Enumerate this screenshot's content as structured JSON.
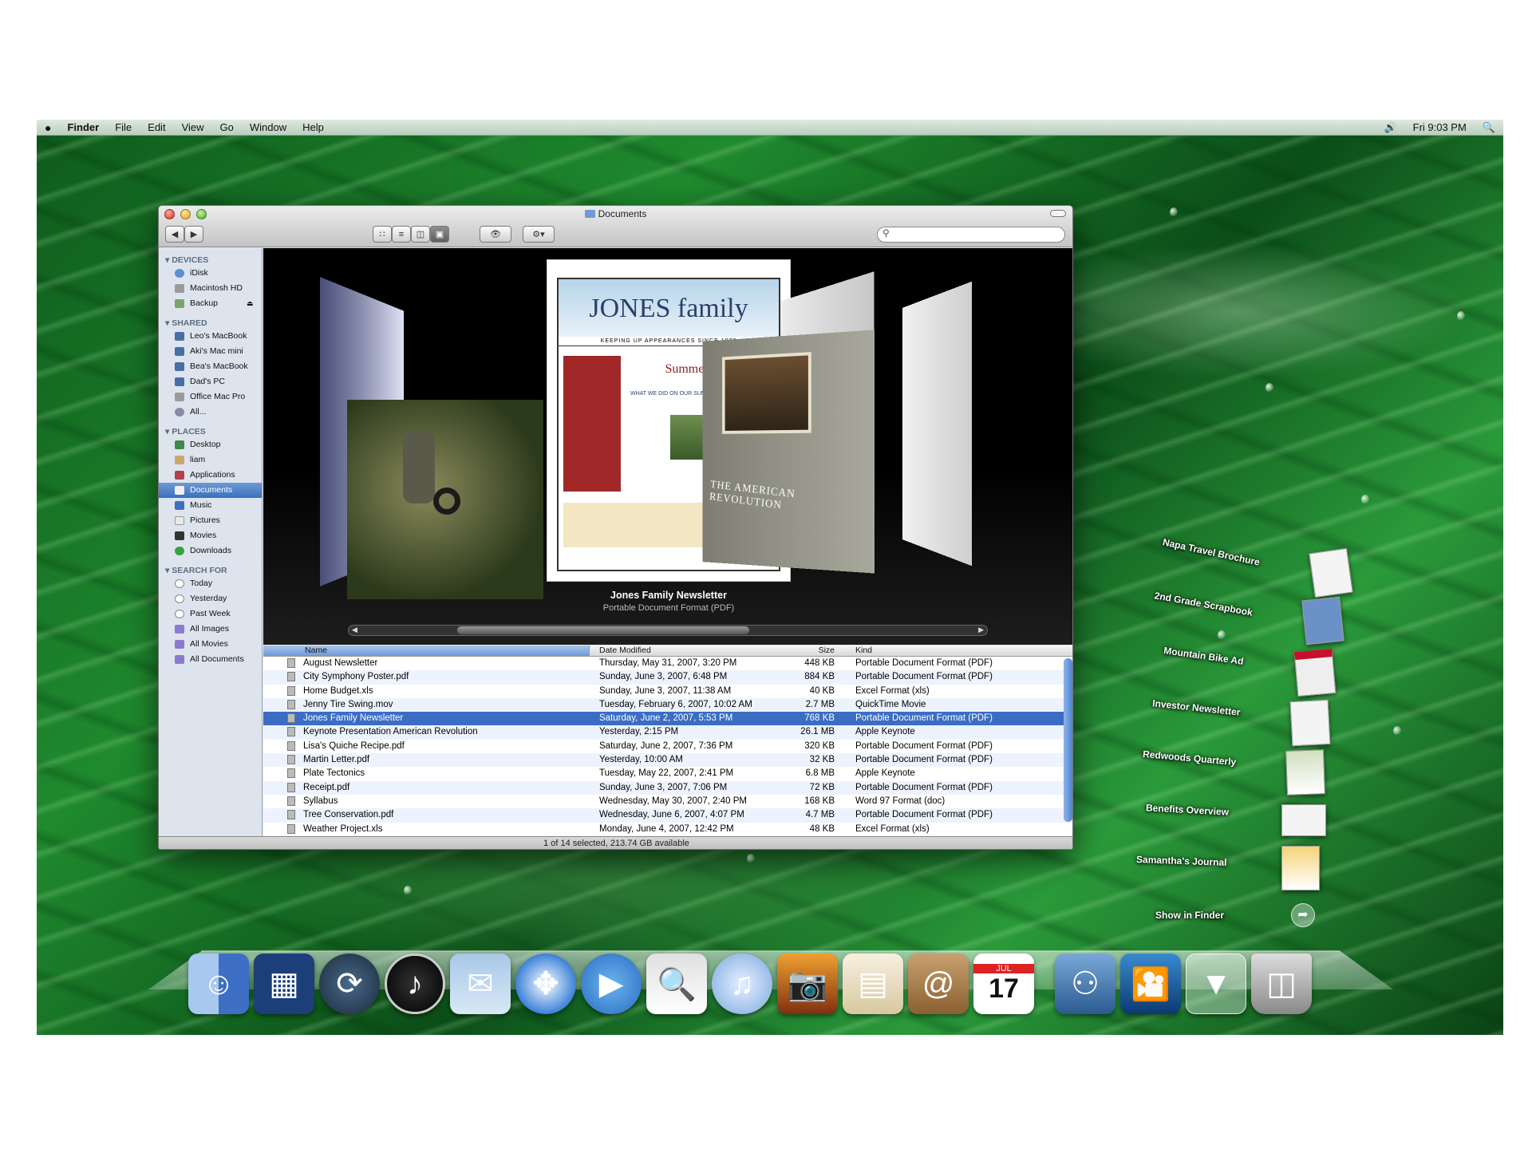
{
  "menubar": {
    "apple": "",
    "app": "Finder",
    "menus": [
      "File",
      "Edit",
      "View",
      "Go",
      "Window",
      "Help"
    ],
    "clock": "Fri 9:03 PM"
  },
  "window": {
    "title": "Documents",
    "search_placeholder": "",
    "status": "1 of 14 selected, 213.74 GB available"
  },
  "sidebar": {
    "devices_label": "DEVICES",
    "devices": [
      "iDisk",
      "Macintosh HD",
      "Backup"
    ],
    "shared_label": "SHARED",
    "shared": [
      "Leo's MacBook",
      "Aki's Mac mini",
      "Bea's MacBook",
      "Dad's PC",
      "Office Mac Pro",
      "All..."
    ],
    "places_label": "PLACES",
    "places": [
      "Desktop",
      "liam",
      "Applications",
      "Documents",
      "Music",
      "Pictures",
      "Movies",
      "Downloads"
    ],
    "search_label": "SEARCH FOR",
    "search": [
      "Today",
      "Yesterday",
      "Past Week",
      "All Images",
      "All Movies",
      "All Documents"
    ]
  },
  "coverflow": {
    "title": "Jones Family Newsletter",
    "subtitle": "Portable Document Format (PDF)",
    "center_doc": {
      "masthead": "JONES family",
      "tagline": "KEEPING UP APPEARANCES SINCE 1973",
      "headline": "Summer's End",
      "sub": "WHAT WE DID ON OUR SUMMER VACATION..."
    },
    "right_doc": "THE AMERICAN REVOLUTION"
  },
  "list": {
    "headers": {
      "name": "Name",
      "date": "Date Modified",
      "size": "Size",
      "kind": "Kind"
    },
    "rows": [
      {
        "name": "August Newsletter",
        "date": "Thursday, May 31, 2007, 3:20 PM",
        "size": "448 KB",
        "kind": "Portable Document Format (PDF)"
      },
      {
        "name": "City Symphony Poster.pdf",
        "date": "Sunday, June 3, 2007, 6:48 PM",
        "size": "884 KB",
        "kind": "Portable Document Format (PDF)"
      },
      {
        "name": "Home Budget.xls",
        "date": "Sunday, June 3, 2007, 11:38 AM",
        "size": "40 KB",
        "kind": "Excel Format (xls)"
      },
      {
        "name": "Jenny Tire Swing.mov",
        "date": "Tuesday, February 6, 2007, 10:02 AM",
        "size": "2.7 MB",
        "kind": "QuickTime Movie"
      },
      {
        "name": "Jones Family Newsletter",
        "date": "Saturday, June 2, 2007, 5:53 PM",
        "size": "768 KB",
        "kind": "Portable Document Format (PDF)"
      },
      {
        "name": "Keynote Presentation American Revolution",
        "date": "Yesterday, 2:15 PM",
        "size": "26.1 MB",
        "kind": "Apple Keynote"
      },
      {
        "name": "Lisa's Quiche Recipe.pdf",
        "date": "Saturday, June 2, 2007, 7:36 PM",
        "size": "320 KB",
        "kind": "Portable Document Format (PDF)"
      },
      {
        "name": "Martin Letter.pdf",
        "date": "Yesterday, 10:00 AM",
        "size": "32 KB",
        "kind": "Portable Document Format (PDF)"
      },
      {
        "name": "Plate Tectonics",
        "date": "Tuesday, May 22, 2007, 2:41 PM",
        "size": "6.8 MB",
        "kind": "Apple Keynote"
      },
      {
        "name": "Receipt.pdf",
        "date": "Sunday, June 3, 2007, 7:06 PM",
        "size": "72 KB",
        "kind": "Portable Document Format (PDF)"
      },
      {
        "name": "Syllabus",
        "date": "Wednesday, May 30, 2007, 2:40 PM",
        "size": "168 KB",
        "kind": "Word 97 Format (doc)"
      },
      {
        "name": "Tree Conservation.pdf",
        "date": "Wednesday, June 6, 2007, 4:07 PM",
        "size": "4.7 MB",
        "kind": "Portable Document Format (PDF)"
      },
      {
        "name": "Weather Project.xls",
        "date": "Monday, June 4, 2007, 12:42 PM",
        "size": "48 KB",
        "kind": "Excel Format (xls)"
      }
    ]
  },
  "stack": {
    "items": [
      "Napa Travel Brochure",
      "2nd Grade Scrapbook",
      "Mountain Bike Ad",
      "Investor Newsletter",
      "Redwoods Quarterly",
      "Benefits Overview",
      "Samantha's Journal"
    ],
    "show_in_finder": "Show in Finder"
  },
  "dock": {
    "calendar_month": "JUL",
    "calendar_day": "17",
    "apps": [
      "finder-icon",
      "dashboard-icon",
      "time-machine-icon",
      "dashboard-widgets-icon",
      "mail-icon",
      "safari-icon",
      "ichat-icon",
      "preview-icon",
      "itunes-icon",
      "iphoto-icon",
      "newsletter-icon",
      "address-book-icon",
      "ical-icon",
      "photos-stack-icon",
      "movie-stack-icon",
      "downloads-stack-icon",
      "trash-icon"
    ]
  }
}
